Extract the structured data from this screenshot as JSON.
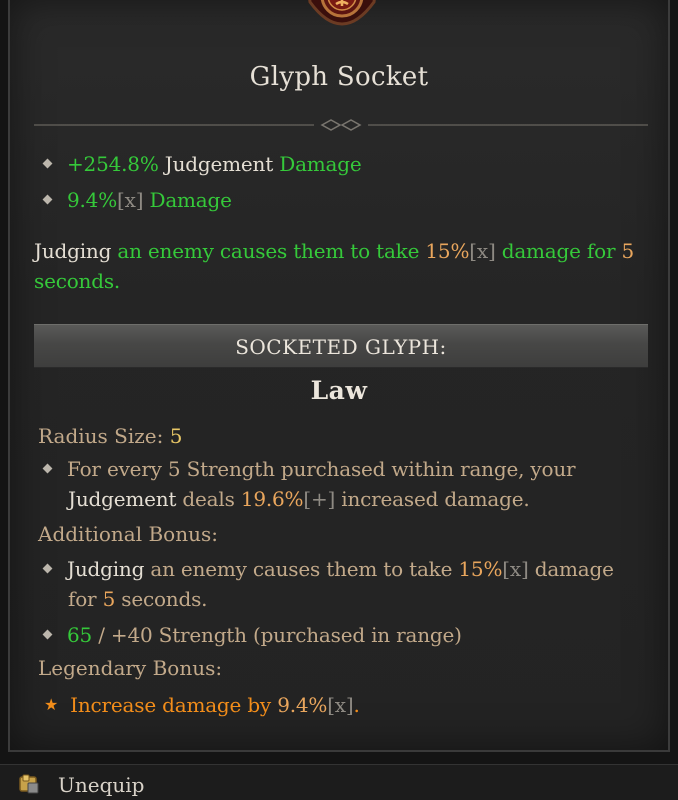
{
  "tooltip": {
    "title": "Glyph Socket",
    "affixes": [
      {
        "value": "+254.8%",
        "stat": "Judgement",
        "suffix": "Damage"
      },
      {
        "value": "9.4%",
        "tag": "[x]",
        "suffix": "Damage"
      }
    ],
    "description": {
      "p1": "Judging",
      "p2": " an enemy causes them to take ",
      "p3": "15%",
      "p4": "[x]",
      "p5": " damage for ",
      "p6": "5",
      "p7": "seconds."
    },
    "banner_label": "SOCKETED GLYPH:",
    "glyph_name": "Law",
    "radius": {
      "label": "Radius Size:",
      "value": "5"
    },
    "radius_bonus": {
      "t1": "For every 5 Strength purchased within range, your",
      "t2": "Judgement",
      "t3": " deals ",
      "t4": "19.6%",
      "t5": "[+]",
      "t6": " increased damage."
    },
    "additional": {
      "label": "Additional Bonus:",
      "t1": "Judging",
      "t2": " an enemy causes them to take ",
      "t3": "15%",
      "t4": "[x]",
      "t5": " damage",
      "t6": "for ",
      "t7": "5",
      "t8": " seconds."
    },
    "strength": {
      "current": "65",
      "sep": " / ",
      "req": "+40 Strength (purchased in range)"
    },
    "legendary": {
      "label": "Legendary Bonus:",
      "t1": "Increase damage by ",
      "t2": "9.4%",
      "t3": "[x]",
      "t4": "."
    }
  },
  "footer": {
    "action": "Unequip"
  },
  "colors": {
    "green": "#35c93a",
    "gold": "#e9a65d",
    "yellow": "#e8c766",
    "orange": "#f28d1a",
    "tan": "#c2a98a"
  },
  "icons": [
    "emblem-crest-icon",
    "divider-ornament-icon",
    "bullet-diamond-icon",
    "legendary-star-icon",
    "unequip-icon"
  ]
}
